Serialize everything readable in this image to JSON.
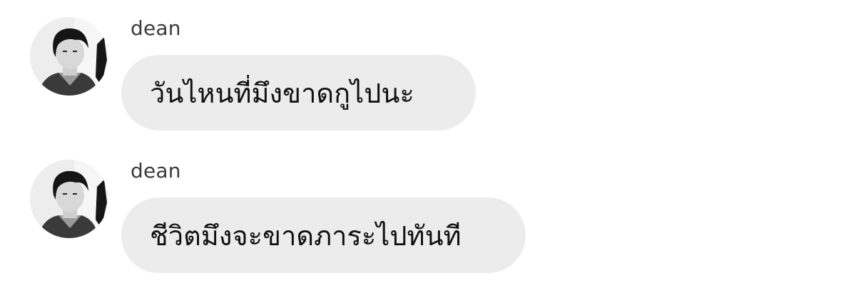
{
  "messages": [
    {
      "sender": "dean",
      "text": "วันไหนที่มึงขาดกูไปนะ",
      "avatar_icon": "user-avatar"
    },
    {
      "sender": "dean",
      "text": "ชีวิตมึงจะขาดภาระไปทันที",
      "avatar_icon": "user-avatar"
    }
  ],
  "colors": {
    "background": "#ffffff",
    "bubble": "#ececec",
    "text": "#111111",
    "sender": "#3a3a3a"
  }
}
